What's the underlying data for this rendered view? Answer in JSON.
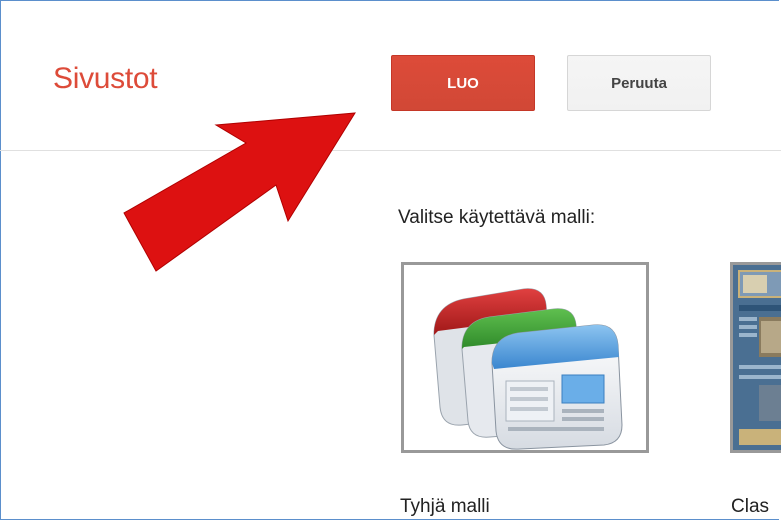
{
  "header": {
    "site_title": "Sivustot",
    "create_label": "LUO",
    "cancel_label": "Peruuta"
  },
  "main": {
    "prompt": "Valitse käytettävä malli:",
    "templates": [
      {
        "label": "Tyhjä malli"
      },
      {
        "label": "Clas"
      }
    ]
  },
  "colors": {
    "accent": "#dd4b39",
    "annotation_arrow": "#dd1111",
    "frame_border": "#5b8fcc"
  },
  "icons": {
    "blank_template": "stacked-documents-icon",
    "annotation": "arrow-pointer-icon"
  }
}
